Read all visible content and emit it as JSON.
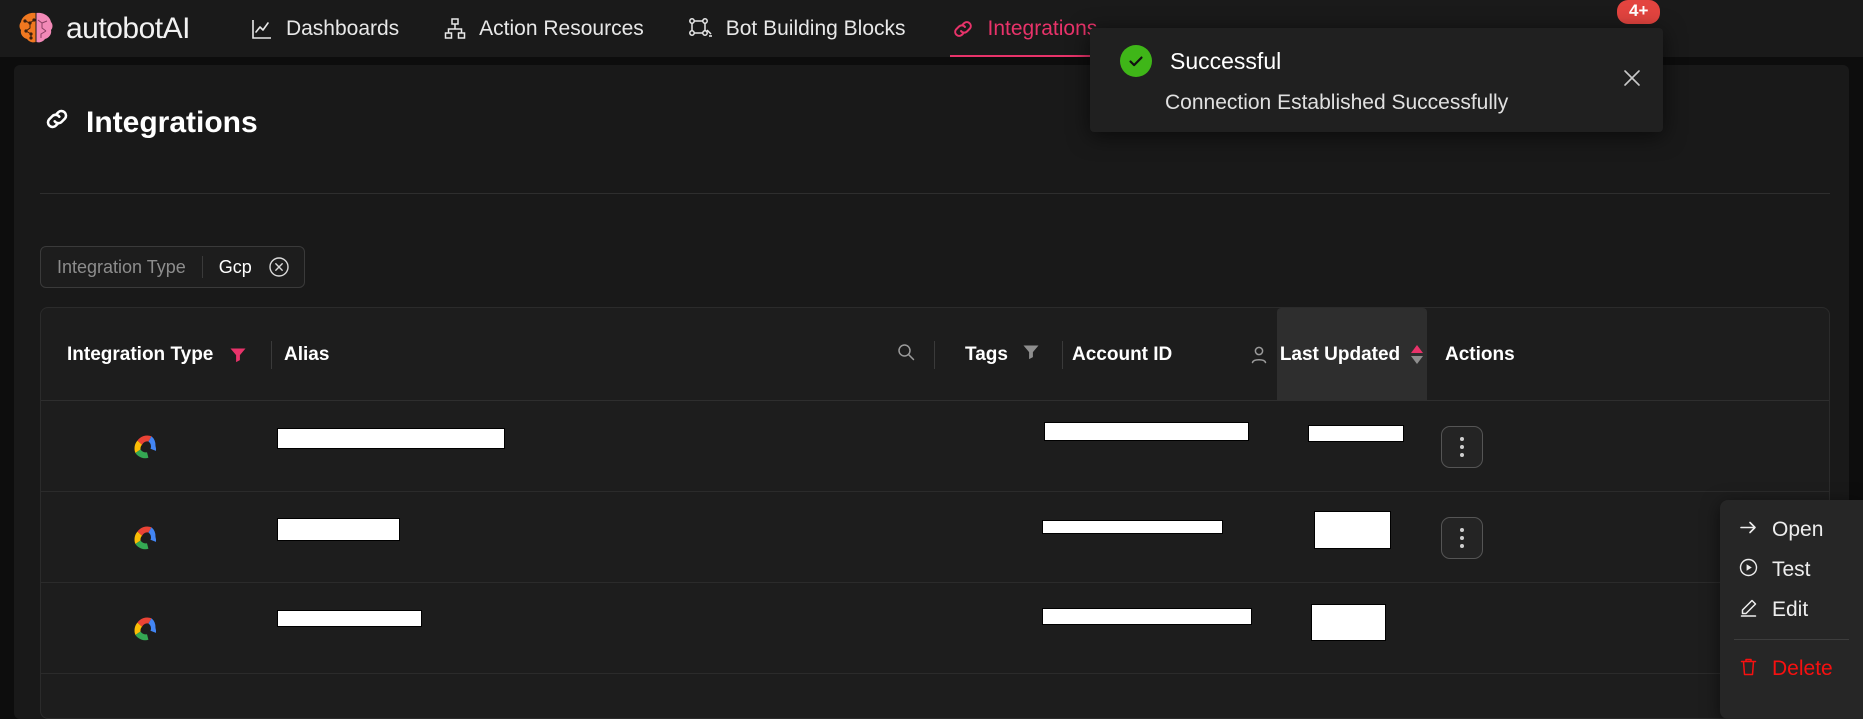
{
  "brand": {
    "name": "autobotAI",
    "logo_icon": "brain-logo-icon"
  },
  "nav": {
    "items": [
      {
        "label": "Dashboards",
        "icon": "chart-line-icon",
        "active": false
      },
      {
        "label": "Action Resources",
        "icon": "sitemap-icon",
        "active": false
      },
      {
        "label": "Bot Building Blocks",
        "icon": "nodes-icon",
        "active": false
      },
      {
        "label": "Integrations",
        "icon": "link-icon",
        "active": true
      }
    ],
    "notification_badge": "4+",
    "active_color": "#e8336a"
  },
  "page": {
    "title": "Integrations",
    "title_icon": "link-icon"
  },
  "filter": {
    "label": "Integration Type",
    "value": "Gcp",
    "clear_icon": "circle-x-icon"
  },
  "table": {
    "columns": [
      {
        "label": "Integration Type",
        "icon": "filter-funnel-icon-active"
      },
      {
        "label": "Alias",
        "icon": ""
      },
      {
        "label": "Tags",
        "icon": "filter-funnel-icon"
      },
      {
        "label": "Account ID",
        "icon": "user-icon"
      },
      {
        "label": "Last Updated",
        "icon": "sort-arrows-icon"
      },
      {
        "label": "Actions",
        "icon": ""
      }
    ],
    "search_icon": "search-icon",
    "rows": [
      {
        "type_icon": "gcp-icon",
        "alias": "",
        "tags": "",
        "account_id": "",
        "last_updated": "",
        "actions_icon": "kebab-menu-icon"
      },
      {
        "type_icon": "gcp-icon",
        "alias": "",
        "tags": "",
        "account_id": "",
        "last_updated": "",
        "actions_icon": "kebab-menu-icon"
      },
      {
        "type_icon": "gcp-icon",
        "alias": "",
        "tags": "",
        "account_id": "",
        "last_updated": "",
        "actions_icon": "kebab-menu-icon"
      }
    ]
  },
  "context_menu": {
    "items": [
      {
        "label": "Open",
        "icon": "arrow-right-icon",
        "danger": false
      },
      {
        "label": "Test",
        "icon": "play-circle-icon",
        "danger": false
      },
      {
        "label": "Edit",
        "icon": "pencil-icon",
        "danger": false
      },
      {
        "label": "Delete",
        "icon": "trash-icon",
        "danger": true
      }
    ]
  },
  "toast": {
    "title": "Successful",
    "message": "Connection Established Successfully",
    "status_icon": "check-circle-icon",
    "close_icon": "close-icon",
    "accent": "#3fb618"
  }
}
